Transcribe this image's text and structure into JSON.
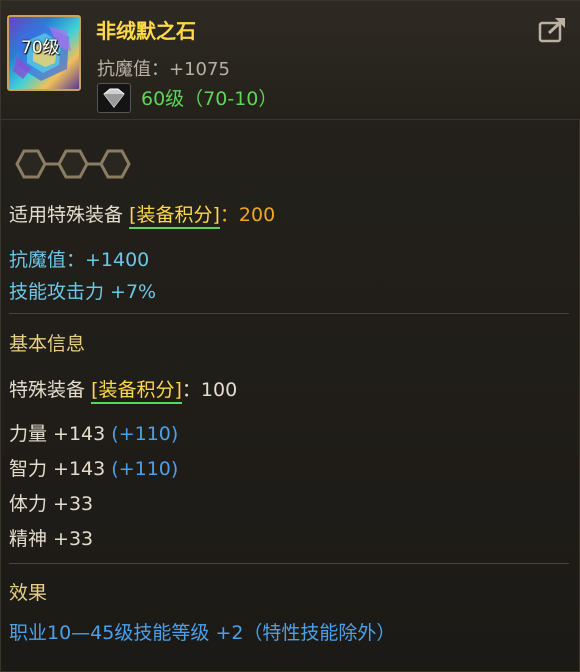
{
  "item": {
    "level_badge": "70级",
    "name": "非绒默之石",
    "resist": "抗魔值：+1075",
    "gem_level": "60级（70-10）"
  },
  "special": {
    "label": "适用特殊装备",
    "tag": "[装备积分]",
    "value": "：200"
  },
  "stats": {
    "magic_resist": "抗魔值：+1400",
    "skill_attack": "技能攻击力 +7%"
  },
  "basic": {
    "heading": "基本信息",
    "special_label": "特殊装备",
    "special_tag": "[装备积分]",
    "special_value": "：100",
    "rows": [
      {
        "name": "力量 +143",
        "bonus": "(+110)"
      },
      {
        "name": "智力 +143",
        "bonus": "(+110)"
      },
      {
        "name": "体力 +33",
        "bonus": ""
      },
      {
        "name": "精神 +33",
        "bonus": ""
      }
    ]
  },
  "effect": {
    "heading": "效果",
    "text": "职业10—45级技能等级 +2（特性技能除外）"
  },
  "colors": {
    "name": "#ffd84a",
    "gem_level": "#5fd45a",
    "stat_cyan": "#6cc6e6",
    "bonus_blue": "#4aa0ea",
    "score": "#f0a81c"
  },
  "icons": [
    "crystal-item-icon",
    "gem-icon",
    "share-icon",
    "socket-icon"
  ]
}
